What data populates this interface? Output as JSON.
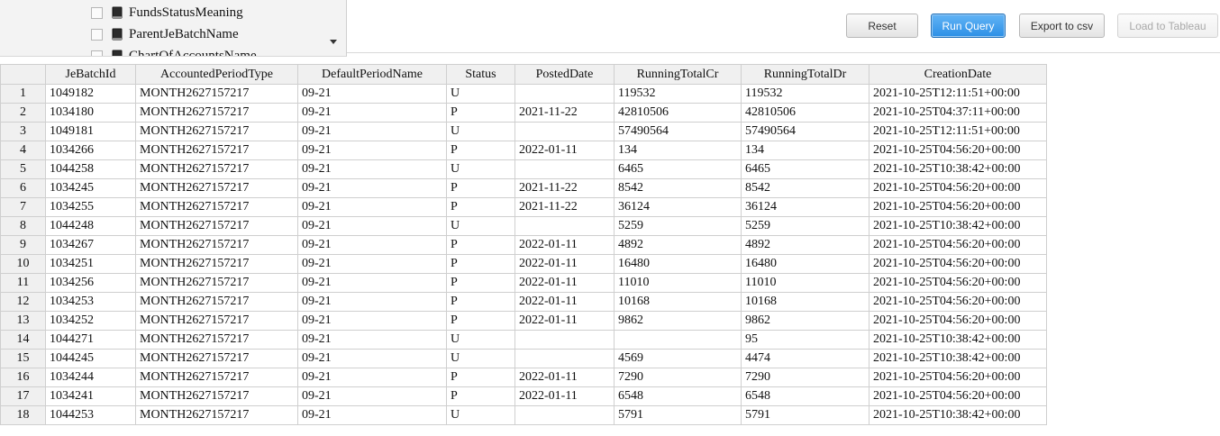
{
  "field_list": {
    "items": [
      {
        "label": "FundsStatusMeaning"
      },
      {
        "label": "ParentJeBatchName"
      },
      {
        "label": "ChartOfAccountsName"
      }
    ]
  },
  "toolbar": {
    "reset_label": "Reset",
    "run_query_label": "Run Query",
    "export_label": "Export to csv",
    "tableau_label": "Load to Tableau"
  },
  "grid": {
    "columns": [
      "",
      "JeBatchId",
      "AccountedPeriodType",
      "DefaultPeriodName",
      "Status",
      "PostedDate",
      "RunningTotalCr",
      "RunningTotalDr",
      "CreationDate"
    ],
    "rows": [
      [
        "1",
        "1049182",
        "MONTH2627157217",
        "09-21",
        "U",
        "",
        "119532",
        "119532",
        "2021-10-25T12:11:51+00:00"
      ],
      [
        "2",
        "1034180",
        "MONTH2627157217",
        "09-21",
        "P",
        "2021-11-22",
        "42810506",
        "42810506",
        "2021-10-25T04:37:11+00:00"
      ],
      [
        "3",
        "1049181",
        "MONTH2627157217",
        "09-21",
        "U",
        "",
        "57490564",
        "57490564",
        "2021-10-25T12:11:51+00:00"
      ],
      [
        "4",
        "1034266",
        "MONTH2627157217",
        "09-21",
        "P",
        "2022-01-11",
        "134",
        "134",
        "2021-10-25T04:56:20+00:00"
      ],
      [
        "5",
        "1044258",
        "MONTH2627157217",
        "09-21",
        "U",
        "",
        "6465",
        "6465",
        "2021-10-25T10:38:42+00:00"
      ],
      [
        "6",
        "1034245",
        "MONTH2627157217",
        "09-21",
        "P",
        "2021-11-22",
        "8542",
        "8542",
        "2021-10-25T04:56:20+00:00"
      ],
      [
        "7",
        "1034255",
        "MONTH2627157217",
        "09-21",
        "P",
        "2021-11-22",
        "36124",
        "36124",
        "2021-10-25T04:56:20+00:00"
      ],
      [
        "8",
        "1044248",
        "MONTH2627157217",
        "09-21",
        "U",
        "",
        "5259",
        "5259",
        "2021-10-25T10:38:42+00:00"
      ],
      [
        "9",
        "1034267",
        "MONTH2627157217",
        "09-21",
        "P",
        "2022-01-11",
        "4892",
        "4892",
        "2021-10-25T04:56:20+00:00"
      ],
      [
        "10",
        "1034251",
        "MONTH2627157217",
        "09-21",
        "P",
        "2022-01-11",
        "16480",
        "16480",
        "2021-10-25T04:56:20+00:00"
      ],
      [
        "11",
        "1034256",
        "MONTH2627157217",
        "09-21",
        "P",
        "2022-01-11",
        "11010",
        "11010",
        "2021-10-25T04:56:20+00:00"
      ],
      [
        "12",
        "1034253",
        "MONTH2627157217",
        "09-21",
        "P",
        "2022-01-11",
        "10168",
        "10168",
        "2021-10-25T04:56:20+00:00"
      ],
      [
        "13",
        "1034252",
        "MONTH2627157217",
        "09-21",
        "P",
        "2022-01-11",
        "9862",
        "9862",
        "2021-10-25T04:56:20+00:00"
      ],
      [
        "14",
        "1044271",
        "MONTH2627157217",
        "09-21",
        "U",
        "",
        "",
        "95",
        "2021-10-25T10:38:42+00:00"
      ],
      [
        "15",
        "1044245",
        "MONTH2627157217",
        "09-21",
        "U",
        "",
        "4569",
        "4474",
        "2021-10-25T10:38:42+00:00"
      ],
      [
        "16",
        "1034244",
        "MONTH2627157217",
        "09-21",
        "P",
        "2022-01-11",
        "7290",
        "7290",
        "2021-10-25T04:56:20+00:00"
      ],
      [
        "17",
        "1034241",
        "MONTH2627157217",
        "09-21",
        "P",
        "2022-01-11",
        "6548",
        "6548",
        "2021-10-25T04:56:20+00:00"
      ],
      [
        "18",
        "1044253",
        "MONTH2627157217",
        "09-21",
        "U",
        "",
        "5791",
        "5791",
        "2021-10-25T10:38:42+00:00"
      ]
    ]
  }
}
